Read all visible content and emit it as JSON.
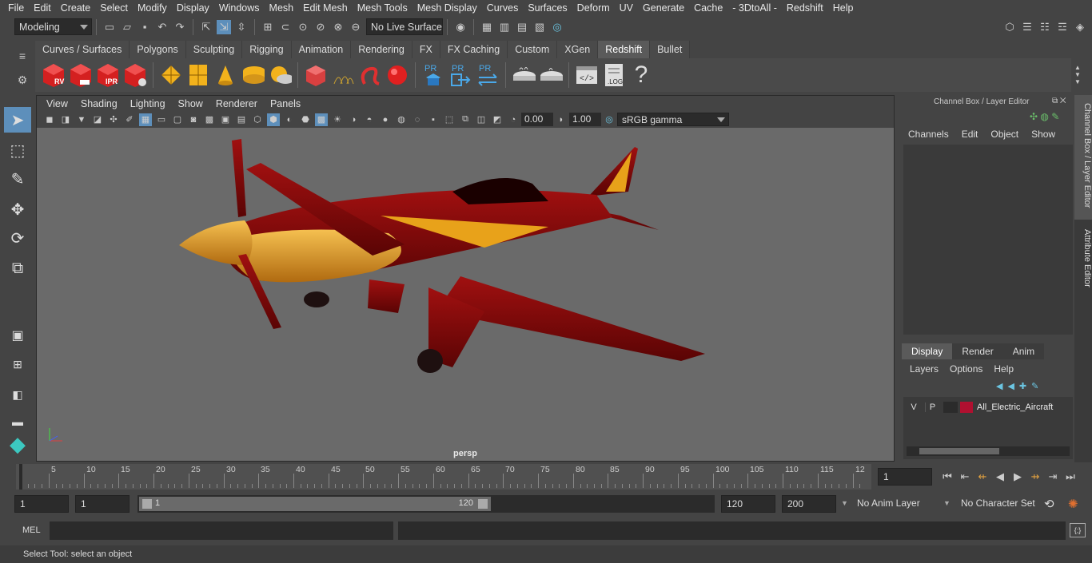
{
  "menubar": [
    "File",
    "Edit",
    "Create",
    "Select",
    "Modify",
    "Display",
    "Windows",
    "Mesh",
    "Edit Mesh",
    "Mesh Tools",
    "Mesh Display",
    "Curves",
    "Surfaces",
    "Deform",
    "UV",
    "Generate",
    "Cache",
    "- 3DtoAll -",
    "Redshift",
    "Help"
  ],
  "status": {
    "mode": "Modeling",
    "live_surface": "No Live Surface"
  },
  "shelf_tabs": [
    "Curves / Surfaces",
    "Polygons",
    "Sculpting",
    "Rigging",
    "Animation",
    "Rendering",
    "FX",
    "FX Caching",
    "Custom",
    "XGen",
    "Redshift",
    "Bullet"
  ],
  "shelf_active": "Redshift",
  "shelf_labels": {
    "rv": "RV",
    "ipr": "IPR",
    "pr1": "PR",
    "pr2": "PR",
    "pr3": "PR",
    "log": ".LOG",
    "help": "?"
  },
  "viewport": {
    "menu": [
      "View",
      "Shading",
      "Lighting",
      "Show",
      "Renderer",
      "Panels"
    ],
    "exposure": "0.00",
    "gamma": "1.00",
    "colorspace": "sRGB gamma",
    "camera": "persp"
  },
  "channelbox": {
    "title": "Channel Box / Layer Editor",
    "menu": [
      "Channels",
      "Edit",
      "Object",
      "Show"
    ],
    "tabs": [
      "Display",
      "Render",
      "Anim"
    ],
    "active_tab": "Display",
    "layer_menu": [
      "Layers",
      "Options",
      "Help"
    ],
    "layer": {
      "v": "V",
      "p": "P",
      "name": "All_Electric_Aircraft",
      "color": "#b01030"
    }
  },
  "side_tabs": {
    "channel": "Channel Box / Layer Editor",
    "attr": "Attribute Editor"
  },
  "timeline": {
    "ticks": [
      "5",
      "10",
      "15",
      "20",
      "25",
      "30",
      "35",
      "40",
      "45",
      "50",
      "55",
      "60",
      "65",
      "70",
      "75",
      "80",
      "85",
      "90",
      "95",
      "100",
      "105",
      "110",
      "115",
      "12"
    ],
    "start_label": "1",
    "current": "1"
  },
  "range": {
    "start": "1",
    "start2": "1",
    "slider_start": "1",
    "slider_end": "120",
    "end": "120",
    "total": "200",
    "anim_layer": "No Anim Layer",
    "char_set": "No Character Set"
  },
  "mel": {
    "label": "MEL"
  },
  "help": "Select Tool: select an object",
  "colors": {
    "accent": "#5d8fbb",
    "plane_red": "#8a0a0a",
    "plane_yellow": "#e8a21a"
  }
}
